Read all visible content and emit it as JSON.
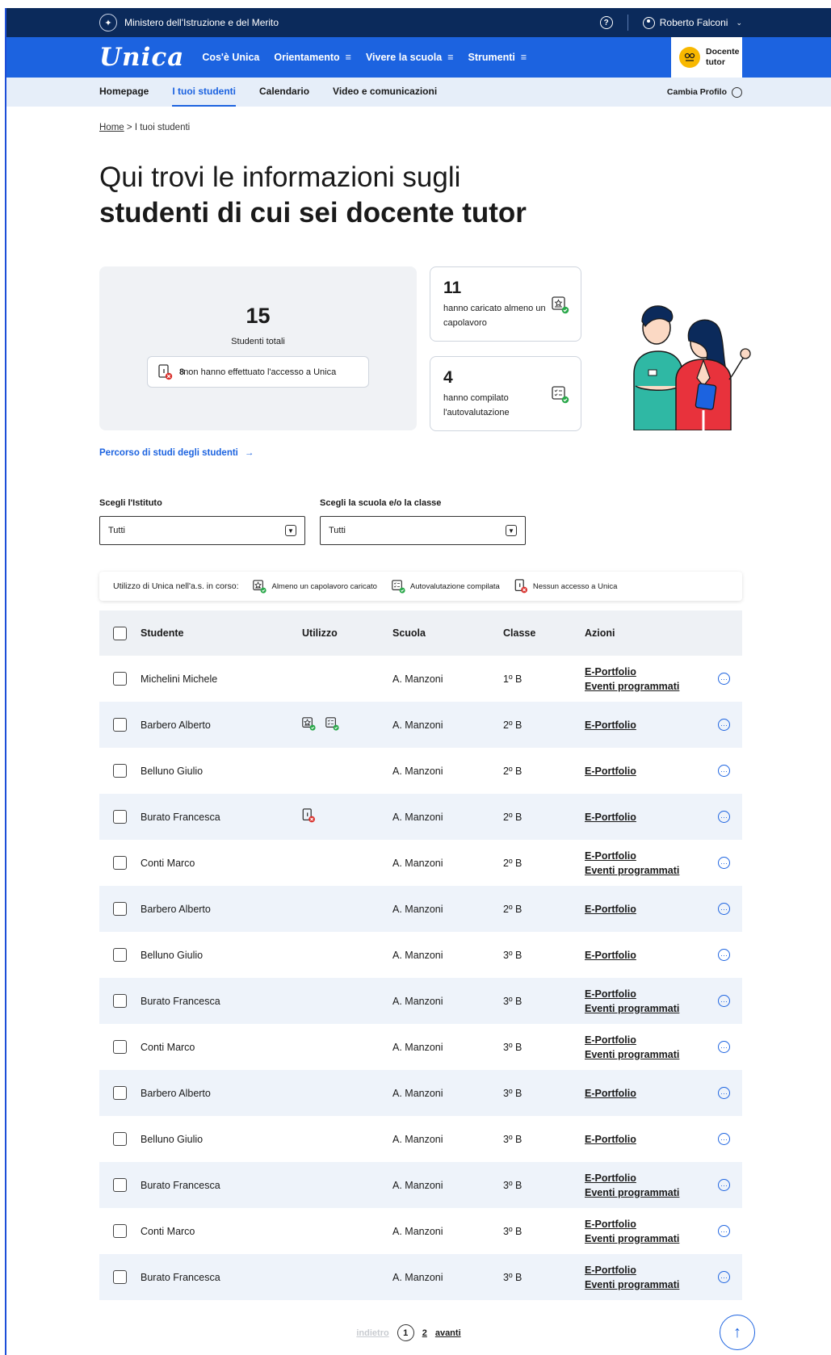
{
  "topbar": {
    "ministry": "Ministero dell'Istruzione e del Merito",
    "user_name": "Roberto Falconi"
  },
  "mainnav": {
    "logo": "Unica",
    "links": [
      "Cos'è Unica",
      "Orientamento",
      "Vivere la scuola",
      "Strumenti"
    ],
    "hamburger": "≡",
    "profile_line1": "Docente",
    "profile_line2": "tutor"
  },
  "subnav": {
    "tabs": [
      "Homepage",
      "I tuoi studenti",
      "Calendario",
      "Video e comunicazioni"
    ],
    "active_tab": "I tuoi studenti",
    "cambia": "Cambia Profilo"
  },
  "breadcrumb": {
    "home": "Home",
    "sep": ">",
    "current": "I tuoi studenti"
  },
  "hero": {
    "line1": "Qui trovi le informazioni sugli",
    "line2": "studenti di cui sei docente tutor"
  },
  "stats": {
    "total_num": "15",
    "total_label": "Studenti totali",
    "noaccess_num": "8",
    "noaccess_label": "non hanno effettuato l'accesso a Unica",
    "capolavoro_num": "11",
    "capolavoro_label": "hanno caricato almeno un capolavoro",
    "autoval_num": "4",
    "autoval_label": "hanno compilato l'autovalutazione"
  },
  "percorso": "Percorso di studi degli studenti",
  "filters": {
    "istituto_label": "Scegli l'Istituto",
    "istituto_value": "Tutti",
    "classe_label": "Scegli la scuola e/o la classe",
    "classe_value": "Tutti"
  },
  "legend": {
    "title": "Utilizzo di Unica nell'a.s. in corso:",
    "capolavoro": "Almeno un capolavoro caricato",
    "autoval": "Autovalutazione compilata",
    "noaccess": "Nessun accesso a Unica"
  },
  "table": {
    "headers": {
      "studente": "Studente",
      "utilizzo": "Utilizzo",
      "scuola": "Scuola",
      "classe": "Classe",
      "azioni": "Azioni"
    },
    "action_portfolio": "E-Portfolio",
    "action_eventi": "Eventi programmati",
    "rows": [
      {
        "name": "Michelini Michele",
        "usage": [],
        "school": "A. Manzoni",
        "class": "1º B",
        "eventi": true
      },
      {
        "name": "Barbero Alberto",
        "usage": [
          "capolavoro",
          "autoval"
        ],
        "school": "A. Manzoni",
        "class": "2º B",
        "eventi": false
      },
      {
        "name": "Belluno Giulio",
        "usage": [],
        "school": "A. Manzoni",
        "class": "2º B",
        "eventi": false
      },
      {
        "name": "Burato Francesca",
        "usage": [
          "noaccess"
        ],
        "school": "A. Manzoni",
        "class": "2º B",
        "eventi": false
      },
      {
        "name": "Conti Marco",
        "usage": [],
        "school": "A. Manzoni",
        "class": "2º B",
        "eventi": true
      },
      {
        "name": "Barbero Alberto",
        "usage": [],
        "school": "A. Manzoni",
        "class": "2º B",
        "eventi": false
      },
      {
        "name": "Belluno Giulio",
        "usage": [],
        "school": "A. Manzoni",
        "class": "3º B",
        "eventi": false
      },
      {
        "name": "Burato Francesca",
        "usage": [],
        "school": "A. Manzoni",
        "class": "3º B",
        "eventi": true
      },
      {
        "name": "Conti Marco",
        "usage": [],
        "school": "A. Manzoni",
        "class": "3º B",
        "eventi": true
      },
      {
        "name": "Barbero Alberto",
        "usage": [],
        "school": "A. Manzoni",
        "class": "3º B",
        "eventi": false
      },
      {
        "name": "Belluno Giulio",
        "usage": [],
        "school": "A. Manzoni",
        "class": "3º B",
        "eventi": false
      },
      {
        "name": "Burato Francesca",
        "usage": [],
        "school": "A. Manzoni",
        "class": "3º B",
        "eventi": true
      },
      {
        "name": "Conti Marco",
        "usage": [],
        "school": "A. Manzoni",
        "class": "3º B",
        "eventi": true
      },
      {
        "name": "Burato Francesca",
        "usage": [],
        "school": "A. Manzoni",
        "class": "3º B",
        "eventi": true
      }
    ]
  },
  "pager": {
    "prev": "indietro",
    "current": "1",
    "page2": "2",
    "next": "avanti"
  },
  "icons": {
    "capolavoro": "capolavoro-icon",
    "autoval": "autovalutazione-icon",
    "noaccess": "no-access-icon",
    "more": "more-options-icon",
    "totop": "arrow-up-icon"
  },
  "colors": {
    "primary": "#1c63e0",
    "dark": "#0b2a5b",
    "accent": "#f8b800",
    "ok": "#2aa84a",
    "error": "#d9302c"
  }
}
